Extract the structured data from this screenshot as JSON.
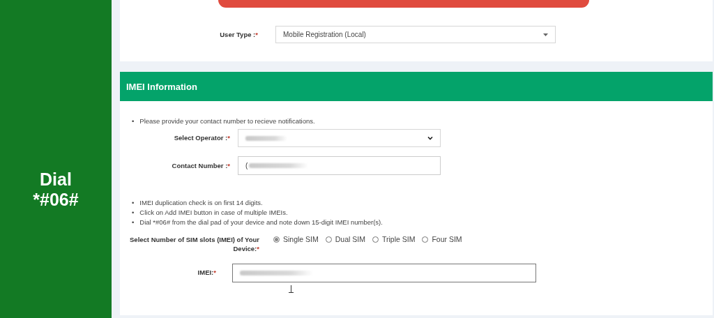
{
  "side_panel": {
    "caption": "Dial *#06#"
  },
  "top_card": {
    "user_type": {
      "label": "User Type :",
      "mark": "*",
      "value": "Mobile Registration (Local)"
    }
  },
  "imei_section": {
    "title": "IMEI Information",
    "contact_notes": [
      {
        "bullet": "•",
        "text": "Please provide your contact number to recieve notifications."
      }
    ],
    "operator": {
      "label": "Select Operator :",
      "mark": "*"
    },
    "contact_number": {
      "label": "Contact Number :",
      "mark": "*",
      "value": "("
    },
    "imei_notes": [
      {
        "bullet": "•",
        "text": "IMEI duplication check is on first 14 digits."
      },
      {
        "bullet": "•",
        "text": "Click on Add IMEI button in case of multiple IMEIs."
      },
      {
        "bullet": "•",
        "text": "Dial *#06# from the dial pad of your device and note down 15-digit IMEI number(s)."
      }
    ],
    "sim_slots": {
      "label": "Select Number of SIM slots (IMEI) of Your Device:",
      "mark": "*",
      "options": [
        {
          "label": "Single SIM",
          "selected": true
        },
        {
          "label": "Dual SIM",
          "selected": false
        },
        {
          "label": "Triple SIM",
          "selected": false
        },
        {
          "label": "Four SIM",
          "selected": false
        }
      ]
    },
    "imei": {
      "label": "IMEI:",
      "mark": "*"
    }
  }
}
